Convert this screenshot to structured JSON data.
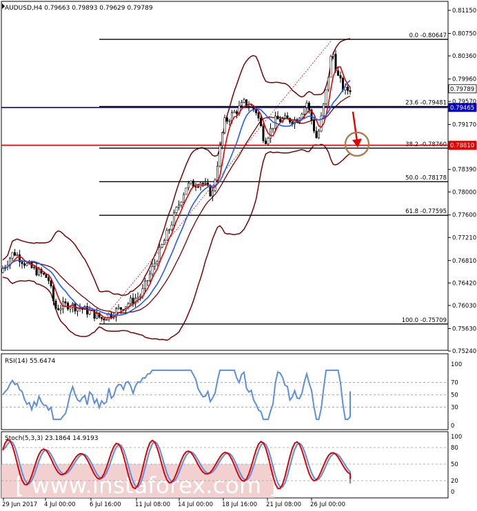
{
  "header": {
    "symbol_line": "AUDUSD,H4  0.79663 0.79893 0.79629 0.79789",
    "rsi_label": "RSI(14) 55.6474",
    "stoch_label": "Stoch(5,3,3) 23.1864 14.9193",
    "watermark": "[ www.instaforex.com ]"
  },
  "colors": {
    "candle": "#000000",
    "fast_ma": "#e00000",
    "slow_ma": "#1e5aff",
    "bands": "#7a0000",
    "support_line": "#0000c8",
    "resistance_line": "#e00000",
    "rsi_line": "#5b8ee0",
    "stoch_main": "#e00000",
    "stoch_signal": "#5b8ee0",
    "arrow": "#e00000",
    "circle": "#b07a50",
    "watermark_bg": "#f0c8c8"
  },
  "chart_data": [
    {
      "type": "candlestick",
      "title": "AUDUSD,H4  0.79663 0.79893 0.79629 0.79789",
      "y_axis_ticks": [
        "0.81150",
        "0.80750",
        "0.80360",
        "0.79960",
        "0.79570",
        "0.79170",
        "0.78790",
        "0.78390",
        "0.78000",
        "0.77600",
        "0.77210",
        "0.76810",
        "0.76420",
        "0.76030",
        "0.75630",
        "0.75240"
      ],
      "ylim": [
        0.7524,
        0.8115
      ],
      "x_tick_labels": [
        "29 Jun 2017",
        "4 Jul 00:00",
        "6 Jul 16:00",
        "11 Jul 08:00",
        "14 Jul 00:00",
        "18 Jul 16:00",
        "21 Jul 08:00",
        "26 Jul 00:00"
      ],
      "price_tags": [
        {
          "value": 0.79789,
          "label": "0.79789",
          "style": "current"
        },
        {
          "value": 0.79465,
          "label": "0.79465",
          "style": "blue"
        },
        {
          "value": 0.7881,
          "label": "0.78810",
          "style": "red"
        }
      ],
      "horizontal_lines": [
        {
          "value": 0.79465,
          "style": "blue"
        },
        {
          "value": 0.7881,
          "style": "red"
        }
      ],
      "fibonacci_levels": [
        {
          "label": "0.0 -0.80647",
          "value": 0.80647
        },
        {
          "label": "23.6 -0.79481",
          "value": 0.79481
        },
        {
          "label": "38.2 -0.78760",
          "value": 0.7876
        },
        {
          "label": "50.0 -0.78178",
          "value": 0.78178
        },
        {
          "label": "61.8 -0.77595",
          "value": 0.77595
        },
        {
          "label": "100.0 -0.75709",
          "value": 0.75709
        }
      ],
      "grid": false
    },
    {
      "type": "line",
      "title": "RSI(14) 55.6474",
      "y_axis_ticks": [
        "100",
        "70",
        "50",
        "30",
        "0"
      ],
      "ylim": [
        0,
        100
      ],
      "levels": [
        70,
        50,
        30
      ],
      "last_value": 55.6474
    },
    {
      "type": "line",
      "title": "Stoch(5,3,3) 23.1864 14.9193",
      "y_axis_ticks": [
        "100",
        "80",
        "50",
        "20",
        "0"
      ],
      "ylim": [
        0,
        100
      ],
      "levels": [
        80,
        50,
        20
      ],
      "last_values": {
        "main": 23.1864,
        "signal": 14.9193
      }
    }
  ]
}
